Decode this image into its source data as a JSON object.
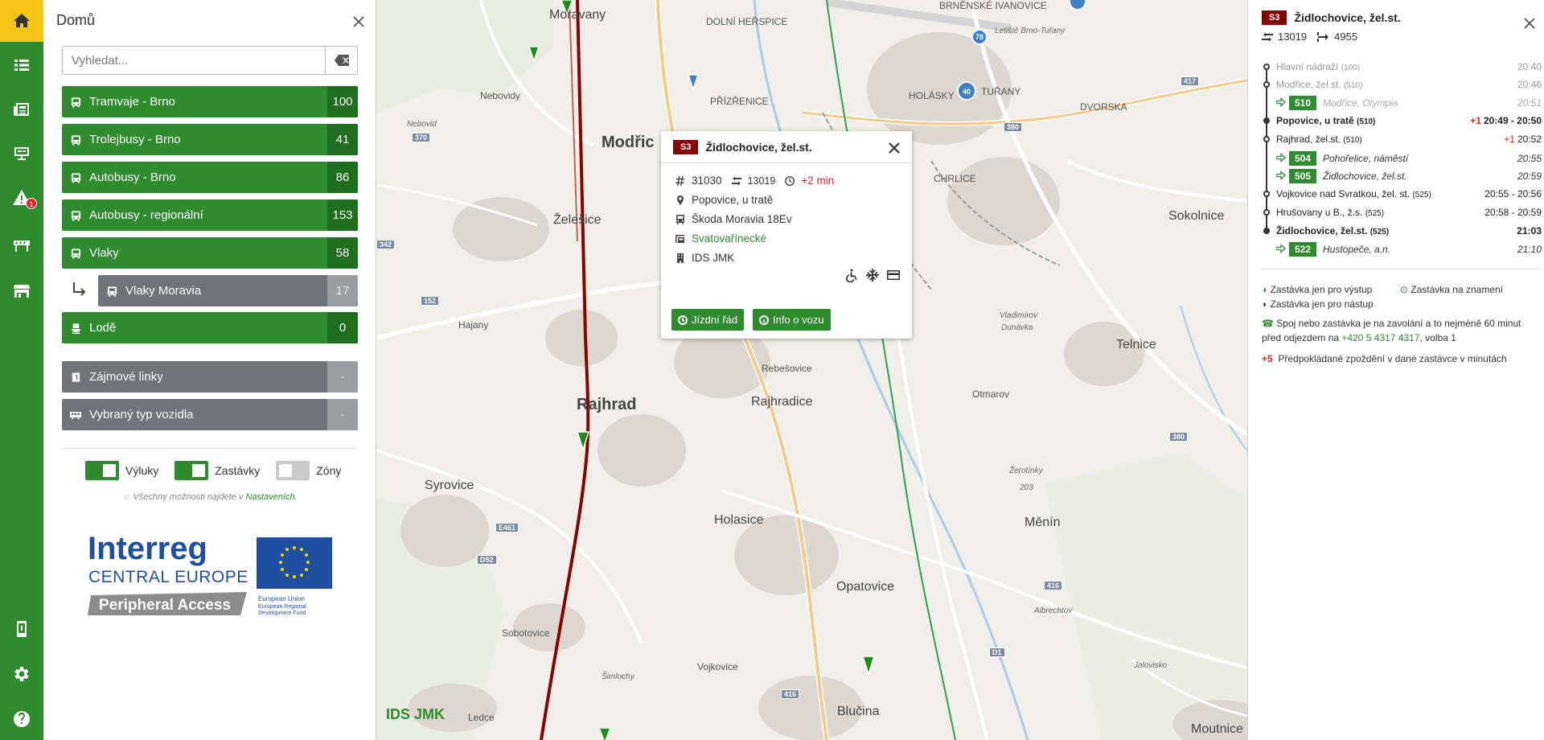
{
  "rail": {
    "items": [
      {
        "icon": "home-icon"
      },
      {
        "icon": "list-icon"
      },
      {
        "icon": "news-icon"
      },
      {
        "icon": "board-icon"
      },
      {
        "icon": "warning-icon",
        "badge": "1"
      },
      {
        "icon": "roadworks-icon"
      },
      {
        "icon": "store-icon"
      },
      {
        "icon": "ticket-phone-icon"
      },
      {
        "icon": "gear-icon"
      },
      {
        "icon": "help-icon"
      }
    ]
  },
  "sidebar": {
    "title": "Domů",
    "search_placeholder": "Vyhledat...",
    "categories": [
      {
        "label": "Tramvaje - Brno",
        "count": "100"
      },
      {
        "label": "Trolejbusy - Brno",
        "count": "41"
      },
      {
        "label": "Autobusy - Brno",
        "count": "86"
      },
      {
        "label": "Autobusy - regionální",
        "count": "153"
      },
      {
        "label": "Vlaky",
        "count": "58"
      },
      {
        "label": "Vlaky Moravia",
        "count": "17"
      },
      {
        "label": "Lodě",
        "count": "0"
      },
      {
        "label": "Zájmové linky",
        "count": "-"
      },
      {
        "label": "Vybraný typ vozidla",
        "count": "-"
      }
    ],
    "toggles": [
      {
        "label": "Výluky",
        "on": true
      },
      {
        "label": "Zastávky",
        "on": true
      },
      {
        "label": "Zóny",
        "on": false
      }
    ],
    "hint_text": "Všechny možnosti najdete v ",
    "hint_link": "Nastaveních",
    "hint_end": ".",
    "logo": {
      "line1": "Interreg",
      "line2": "CENTRAL EUROPE",
      "line3": "Peripheral Access",
      "eu1": "European Union",
      "eu2": "European Regional",
      "eu3": "Development Fund"
    }
  },
  "map": {
    "towns": [
      {
        "name": "Moravany",
        "cls": "mid"
      },
      {
        "name": "DOLNÍ HEŘSPICE",
        "cls": "small"
      },
      {
        "name": "BRNĚNSKÉ IVANOVICE",
        "cls": "small"
      },
      {
        "name": "Letiště Brno-Tuřany",
        "cls": "tiny"
      },
      {
        "name": "Nebovidy",
        "cls": "small"
      },
      {
        "name": "PŘÍZŘENICE",
        "cls": "small"
      },
      {
        "name": "HOLÁSKY",
        "cls": "small"
      },
      {
        "name": "TUŘANY",
        "cls": "small"
      },
      {
        "name": "DVORSKA",
        "cls": "small"
      },
      {
        "name": "Modřic",
        "cls": "big"
      },
      {
        "name": "CHRLICE",
        "cls": "small"
      },
      {
        "name": "Želešice",
        "cls": "mid"
      },
      {
        "name": "Sokolnice",
        "cls": "mid"
      },
      {
        "name": "Hajany",
        "cls": "small"
      },
      {
        "name": "Telnice",
        "cls": "mid"
      },
      {
        "name": "Rajhrad",
        "cls": "big"
      },
      {
        "name": "Rebešovice",
        "cls": "small"
      },
      {
        "name": "Rajhradice",
        "cls": "mid"
      },
      {
        "name": "Otmarov",
        "cls": "small"
      },
      {
        "name": "Syrovice",
        "cls": "mid"
      },
      {
        "name": "Holasice",
        "cls": "mid"
      },
      {
        "name": "Měnín",
        "cls": "mid"
      },
      {
        "name": "Opatovice",
        "cls": "mid"
      },
      {
        "name": "Sobotovice",
        "cls": "small"
      },
      {
        "name": "Vojkovice",
        "cls": "small"
      },
      {
        "name": "Blučina",
        "cls": "mid"
      },
      {
        "name": "Ledce",
        "cls": "small"
      },
      {
        "name": "Moutnice",
        "cls": "mid"
      },
      {
        "name": "Nebovid",
        "cls": "tiny"
      },
      {
        "name": "Vladimírov",
        "cls": "tiny"
      },
      {
        "name": "Dunávka",
        "cls": "tiny"
      },
      {
        "name": "Žerotínky",
        "cls": "tiny"
      },
      {
        "name": "Albrechtov",
        "cls": "tiny"
      },
      {
        "name": "Jalovisko",
        "cls": "tiny"
      },
      {
        "name": "Šimlochy",
        "cls": "tiny"
      }
    ],
    "roads": [
      "370",
      "152",
      "E461",
      "D52",
      "417",
      "380",
      "380",
      "416",
      "416",
      "D1",
      "342",
      "203"
    ],
    "ids_logo": "IDS JMK"
  },
  "popup": {
    "line": "S3",
    "title": "Židlochovice, žel.st.",
    "vehicle_no": "31030",
    "trip_no": "13019",
    "delay": "+2 min",
    "stop": "Popovice, u tratě",
    "vehicle": "Škoda Moravia 18Ev",
    "depot": "Svatovařínecké",
    "operator": "IDS JMK",
    "btn_timetable": "Jízdní řád",
    "btn_info": "Info o vozu"
  },
  "panel": {
    "line": "S3",
    "title": "Židlochovice, žel.st.",
    "trip_no": "13019",
    "block_no": "4955",
    "stops": [
      {
        "name": "Hlavní nádraží",
        "zone": "(100)",
        "time": "20:40",
        "past": true
      },
      {
        "name": "Modřice, žel.st.",
        "zone": "(510)",
        "time": "20:46",
        "past": true
      },
      {
        "conn_line": "510",
        "dest": "Modřice, Olympia",
        "time": "20:51",
        "past": true
      },
      {
        "name": "Popovice, u tratě",
        "zone": "(510)",
        "plus": "+1",
        "time": "20:49 - 20:50",
        "bold": true
      },
      {
        "name": "Rajhrad, žel.st.",
        "zone": "(510)",
        "plus": "+1",
        "time": "20:52"
      },
      {
        "conn_line": "504",
        "dest": "Pohořelice, náměstí",
        "time": "20:55"
      },
      {
        "conn_line": "505",
        "dest": "Židlochovice, žel.st.",
        "time": "20:59"
      },
      {
        "name": "Vojkovice nad Svratkou, žel. st.",
        "zone": "(525)",
        "time": "20:55 - 20:56"
      },
      {
        "name": "Hrušovany u B., ž.s.",
        "zone": "(525)",
        "time": "20:58 - 20:59"
      },
      {
        "name": "Židlochovice, žel.st.",
        "zone": "(525)",
        "time": "21:03",
        "bold": true
      },
      {
        "conn_line": "522",
        "dest": "Hustopeče, a.n.",
        "time": "21:10"
      }
    ],
    "legend": {
      "exit_only": "Zastávka jen pro výstup",
      "on_request": "Zastávka na znamení",
      "board_only": "Zastávka jen pro nástup",
      "phone_text_1": "Spoj nebo zastávka je na zavolání a to nejméně 60 minut před odjezdem na ",
      "phone_number": "+420 5 4317 4317",
      "phone_text_2": ", volba 1",
      "delay_sample": "+5",
      "delay_text": "Předpokládané zpoždění v dané zastávce v minutách"
    }
  },
  "colors": {
    "brand_green": "#2e8b2e",
    "accent_yellow": "#f5c518",
    "line_red": "#8b0000",
    "delay_red": "#e02424"
  }
}
